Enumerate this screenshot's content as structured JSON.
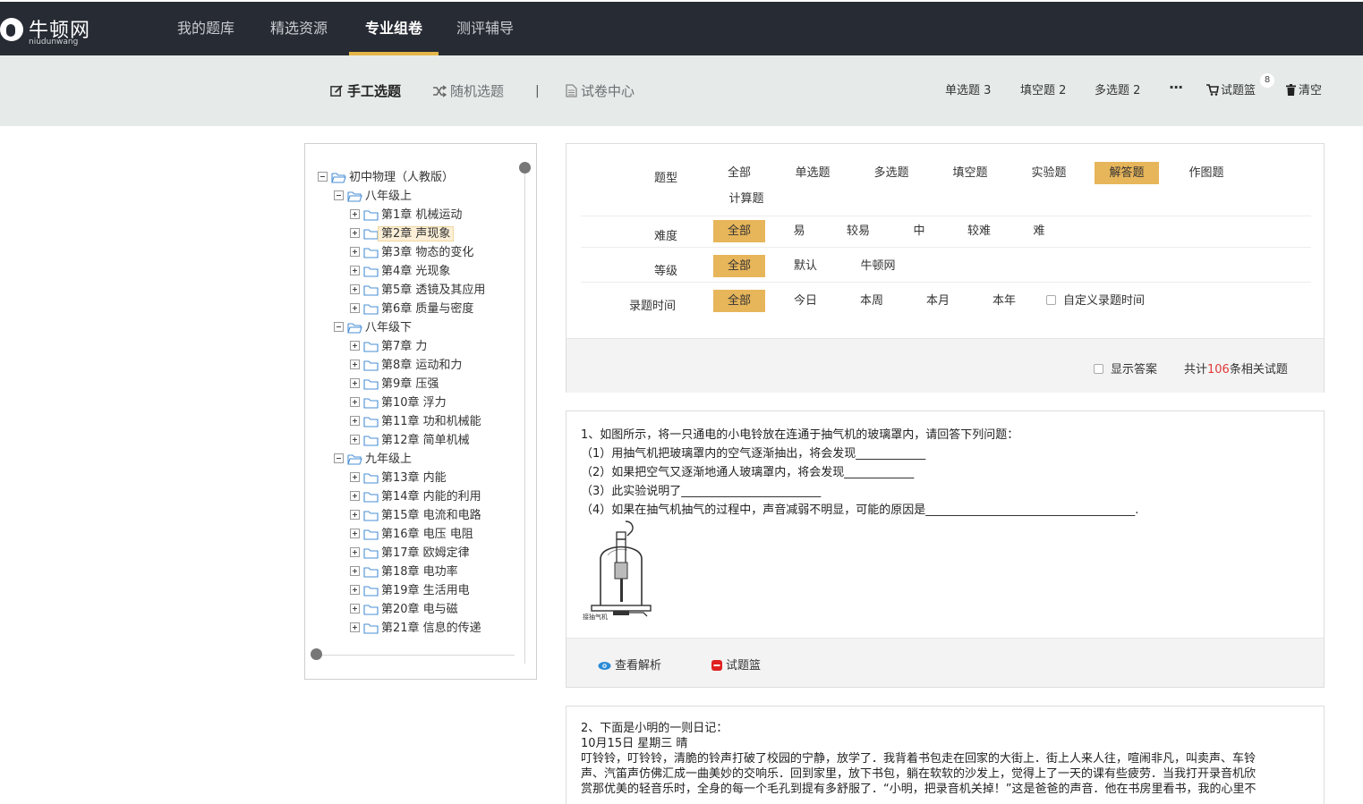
{
  "logo": {
    "cn": "牛顿网",
    "en": "niudunwang"
  },
  "nav": [
    {
      "label": "我的题库"
    },
    {
      "label": "精选资源"
    },
    {
      "label": "专业组卷",
      "active": true
    },
    {
      "label": "测评辅导"
    }
  ],
  "subnav": {
    "manual": "手工选题",
    "random": "随机选题",
    "separator": "|",
    "paper_center": "试卷中心",
    "counts": [
      "单选题 3",
      "填空题 2",
      "多选题 2"
    ],
    "more": "···",
    "basket": "试题篮",
    "basket_badge": "8",
    "clear": "清空"
  },
  "tree": {
    "root": "初中物理（人教版）",
    "grades": [
      {
        "name": "八年级上",
        "chapters": [
          "第1章 机械运动",
          "第2章 声现象",
          "第3章 物态的变化",
          "第4章 光现象",
          "第5章 透镜及其应用",
          "第6章 质量与密度"
        ]
      },
      {
        "name": "八年级下",
        "chapters": [
          "第7章 力",
          "第8章 运动和力",
          "第9章 压强",
          "第10章 浮力",
          "第11章 功和机械能",
          "第12章 简单机械"
        ]
      },
      {
        "name": "九年级上",
        "chapters": [
          "第13章 内能",
          "第14章 内能的利用",
          "第15章 电流和电路",
          "第16章 电压 电阻",
          "第17章 欧姆定律",
          "第18章 电功率",
          "第19章 生活用电",
          "第20章 电与磁",
          "第21章 信息的传递"
        ]
      }
    ],
    "selected": "第2章 声现象"
  },
  "filter": {
    "type_label": "题型",
    "types": [
      "全部",
      "单选题",
      "多选题",
      "填空题",
      "实验题",
      "解答题",
      "作图题",
      "计算题"
    ],
    "type_selected": "解答题",
    "difficulty_label": "难度",
    "difficulties": [
      "全部",
      "易",
      "较易",
      "中",
      "较难",
      "难"
    ],
    "grade_label": "等级",
    "grades": [
      "全部",
      "默认",
      "牛顿网"
    ],
    "time_label": "录题时间",
    "times": [
      "全部",
      "今日",
      "本周",
      "本月",
      "本年"
    ],
    "custom_time": "自定义录题时间",
    "show_answer": "显示答案",
    "total_prefix": "共计",
    "total_num": "106",
    "total_suffix": "条相关试题"
  },
  "questions": [
    {
      "lines": [
        "1、如图所示，将一只通电的小电铃放在连通于抽气机的玻璃罩内，请回答下列问题：",
        "（1）用抽气机把玻璃罩内的空气逐渐抽出，将会发现____________",
        "（2）如果把空气又逐渐地通人玻璃罩内，将会发现____________",
        "（3）此实验说明了________________________",
        "（4）如果在抽气机抽气的过程中，声音减弱不明显，可能的原因是____________________________________."
      ],
      "figure_caption": "接抽气机",
      "view_analysis": "查看解析",
      "basket": "试题篮"
    },
    {
      "lines": [
        "2、下面是小明的一则日记：",
        "10月15日     星期三     晴",
        "叮铃铃，叮铃铃，清脆的铃声打破了校园的宁静，放学了．我背着书包走在回家的大街上．街上人来人往，喧闹非凡，叫卖声、车铃",
        "声、汽笛声仿佛汇成一曲美妙的交响乐．回到家里，放下书包，躺在软软的沙发上，觉得上了一天的课有些疲劳．当我打开录音机欣",
        "赏那优美的轻音乐时，全身的每一个毛孔到提有多舒服了．“小明，把录音机关掉！”这是爸爸的声音．他在书房里看书，我的心里不"
      ]
    }
  ],
  "colors": {
    "nav_bg": "#272b33",
    "accent": "#e7b55a",
    "subbar_bg": "#e6ebe9",
    "count_red": "#e03a3a"
  }
}
